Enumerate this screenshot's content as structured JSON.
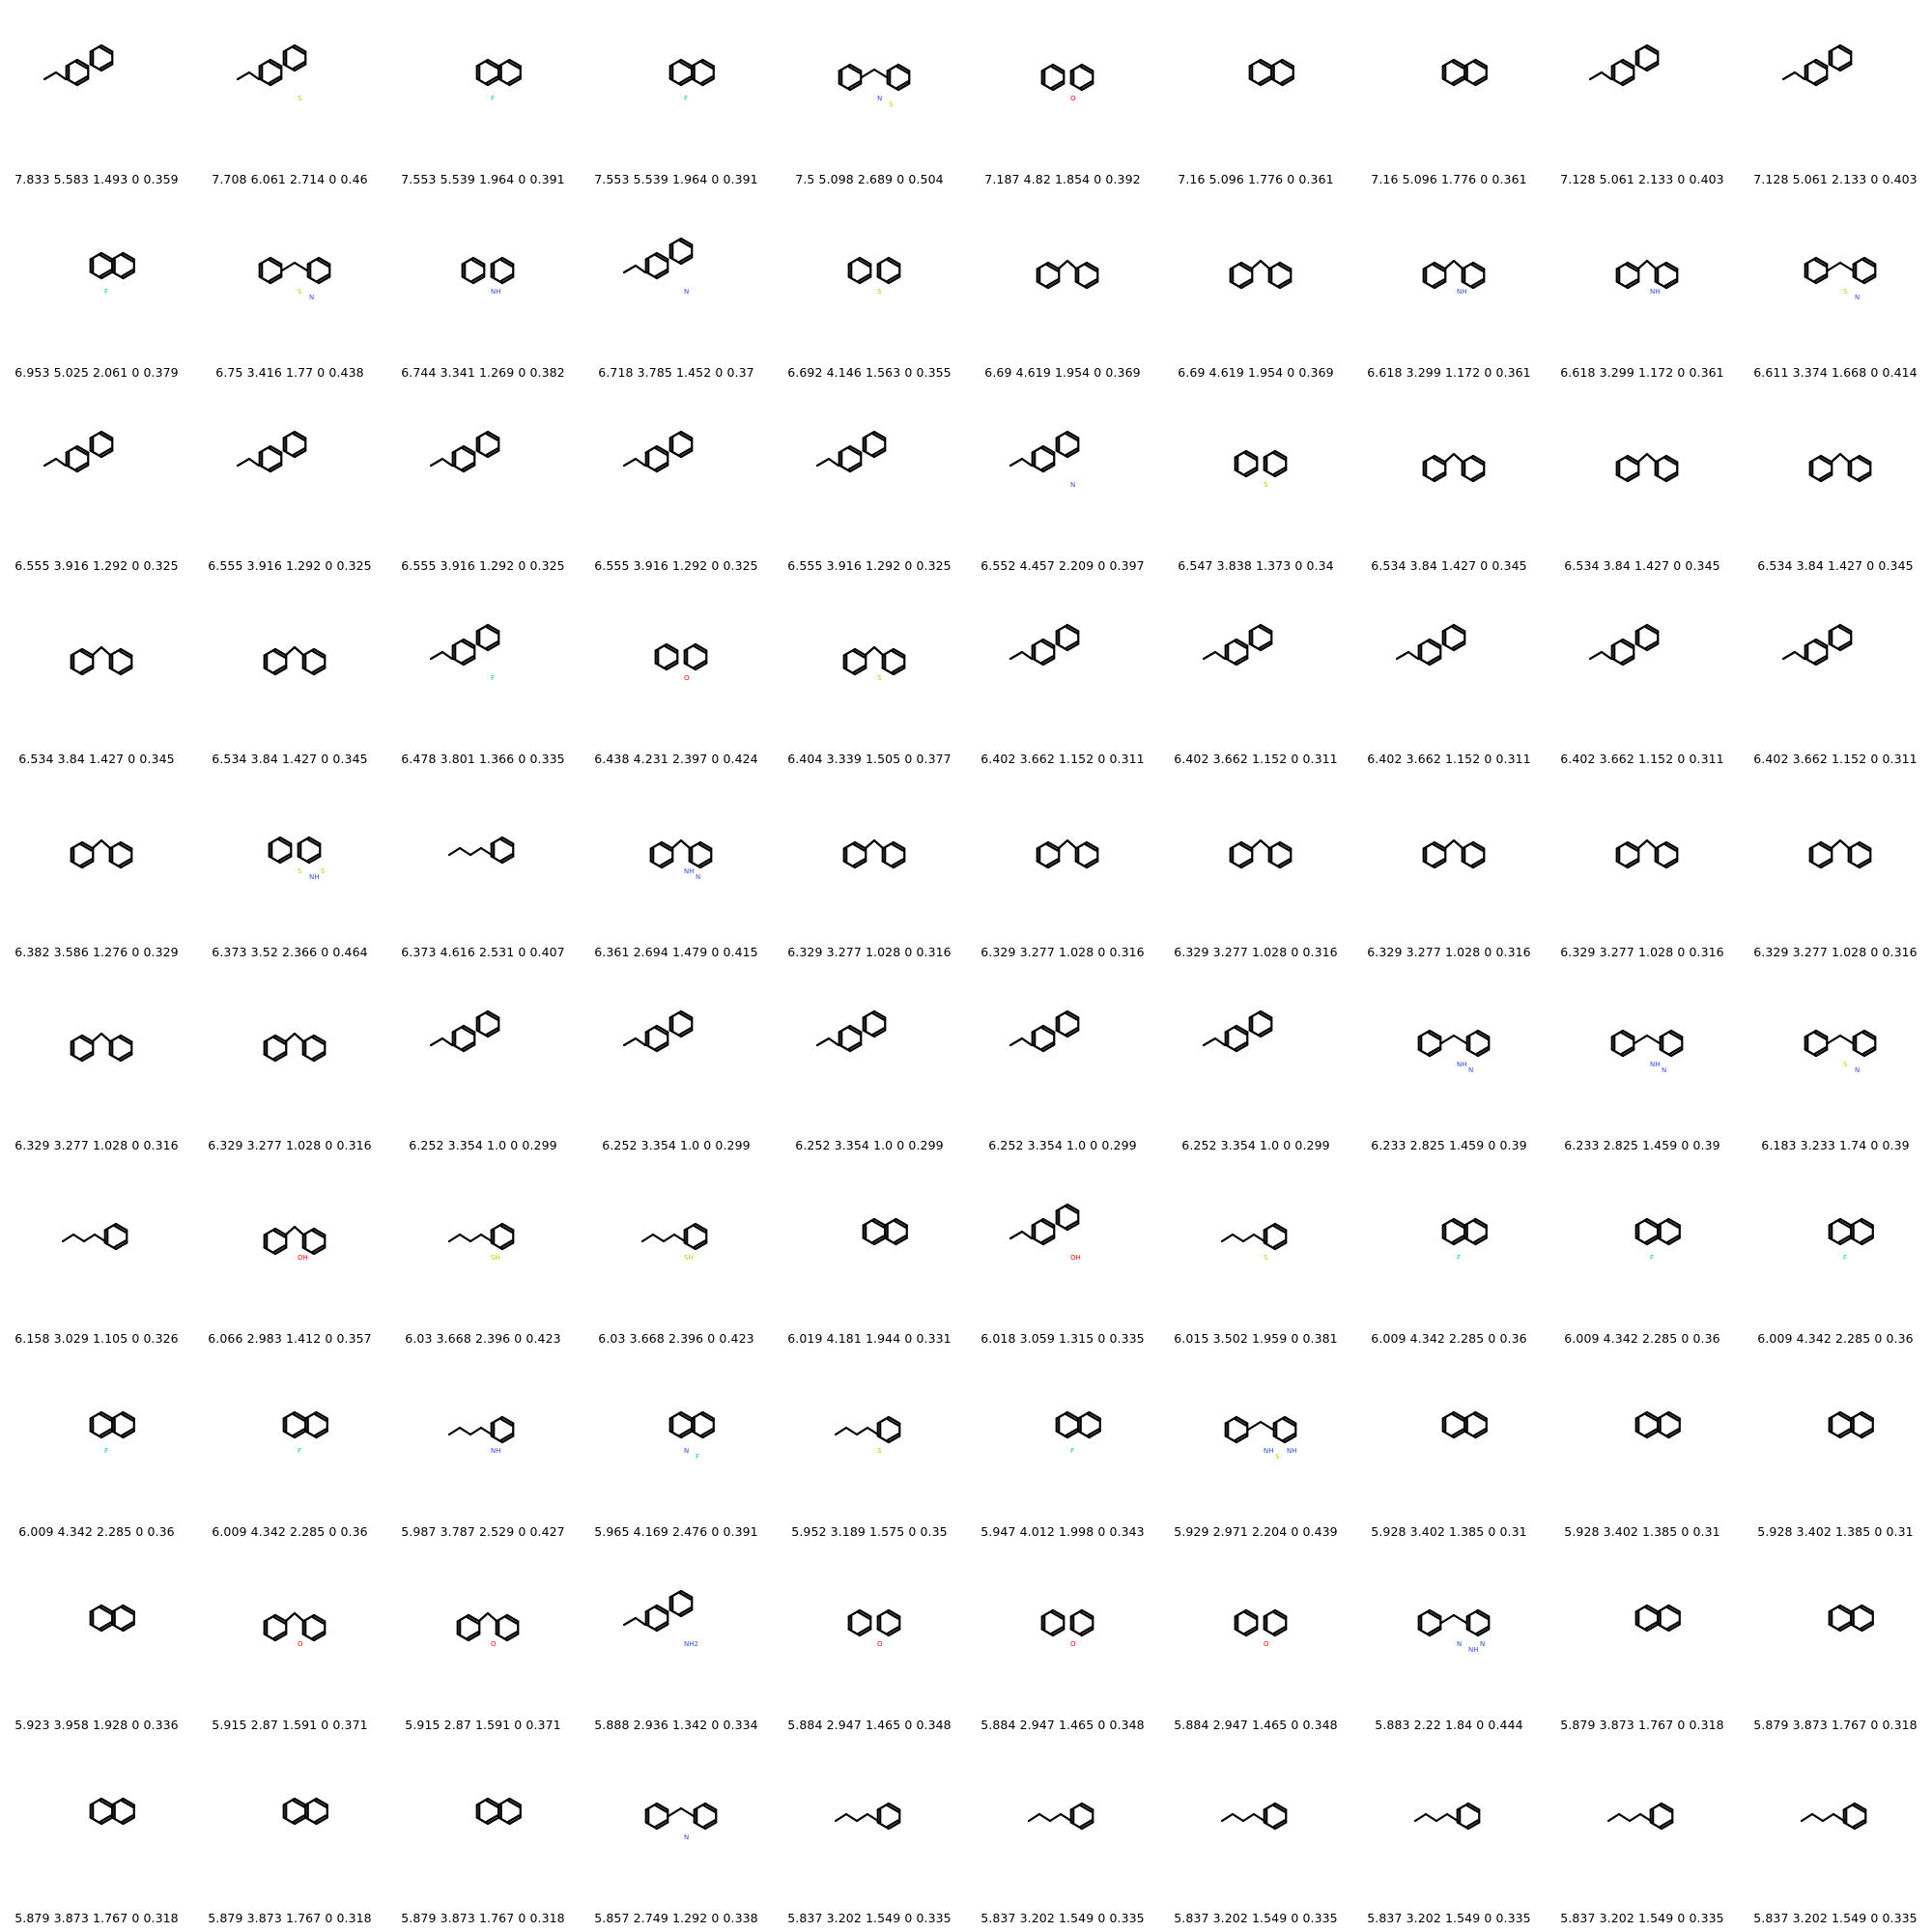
{
  "grid": {
    "rows": 10,
    "cols": 10
  },
  "bond_color": "#000000",
  "atom_colors": {
    "O": "#ff0d0d",
    "N": "#3050f8",
    "S": "#c8c800",
    "F": "#00c8c8"
  },
  "molecules": [
    {
      "caption": "7.833 5.583 1.493 0 0.359",
      "icon": "biaryl-ethyl-molecule-icon"
    },
    {
      "caption": "7.708 6.061 2.714 0 0.46",
      "icon": "biaryl-thio-diene-molecule-icon",
      "het": [
        {
          "el": "S"
        }
      ]
    },
    {
      "caption": "7.553 5.539 1.964 0 0.391",
      "icon": "naphthyl-biaryl-molecule-icon",
      "het": [
        {
          "el": "F"
        }
      ]
    },
    {
      "caption": "7.553 5.539 1.964 0 0.391",
      "icon": "naphthyl-biaryl-molecule-icon",
      "het": [
        {
          "el": "F"
        }
      ]
    },
    {
      "caption": "7.5 5.098 2.689 0 0.504",
      "icon": "pyridyl-thio-triene-molecule-icon",
      "het": [
        {
          "el": "N"
        },
        {
          "el": "S"
        }
      ]
    },
    {
      "caption": "7.187 4.82 1.854 0 0.392",
      "icon": "diaryl-ether-molecule-icon",
      "het": [
        {
          "el": "O"
        }
      ]
    },
    {
      "caption": "7.16 5.096 1.776 0 0.361",
      "icon": "naphthyl-allyl-benzene-molecule-icon"
    },
    {
      "caption": "7.16 5.096 1.776 0 0.361",
      "icon": "naphthyl-allyl-benzene-molecule-icon"
    },
    {
      "caption": "7.128 5.061 2.133 0 0.403",
      "icon": "diene-linked-biaryl-molecule-icon"
    },
    {
      "caption": "7.128 5.061 2.133 0 0.403",
      "icon": "diene-linked-biaryl-molecule-icon"
    },
    {
      "caption": "6.953 5.025 2.061 0 0.379",
      "icon": "phenanthrene-molecule-icon",
      "het": [
        {
          "el": "F"
        }
      ]
    },
    {
      "caption": "6.75 3.416 1.77 0 0.438",
      "icon": "thioether-pyridine-molecule-icon",
      "het": [
        {
          "el": "S"
        },
        {
          "el": "N"
        }
      ]
    },
    {
      "caption": "6.744 3.341 1.269 0 0.382",
      "icon": "amine-linked-benzene-molecule-icon",
      "het": [
        {
          "el": "NH"
        }
      ]
    },
    {
      "caption": "6.718 3.785 1.452 0 0.37",
      "icon": "aminobiphenyl-molecule-icon",
      "het": [
        {
          "el": "N"
        }
      ]
    },
    {
      "caption": "6.692 4.146 1.563 0 0.355",
      "icon": "diaryl-sulfide-molecule-icon",
      "het": [
        {
          "el": "S"
        }
      ]
    },
    {
      "caption": "6.69 4.619 1.954 0 0.369",
      "icon": "diarylmethane-molecule-icon"
    },
    {
      "caption": "6.69 4.619 1.954 0 0.369",
      "icon": "diarylmethane-molecule-icon"
    },
    {
      "caption": "6.618 3.299 1.172 0 0.361",
      "icon": "benzylaniline-molecule-icon",
      "het": [
        {
          "el": "NH"
        }
      ]
    },
    {
      "caption": "6.618 3.299 1.172 0 0.361",
      "icon": "benzylaniline-molecule-icon",
      "het": [
        {
          "el": "NH"
        }
      ]
    },
    {
      "caption": "6.611 3.374 1.668 0 0.414",
      "icon": "thioether-pyridine-molecule-icon",
      "het": [
        {
          "el": "S"
        },
        {
          "el": "N"
        }
      ]
    },
    {
      "caption": "6.555 3.916 1.292 0 0.325",
      "icon": "ethylbiphenyl-molecule-icon"
    },
    {
      "caption": "6.555 3.916 1.292 0 0.325",
      "icon": "ethylbiphenyl-molecule-icon"
    },
    {
      "caption": "6.555 3.916 1.292 0 0.325",
      "icon": "ethylbiphenyl-molecule-icon"
    },
    {
      "caption": "6.555 3.916 1.292 0 0.325",
      "icon": "ethylbiphenyl-molecule-icon"
    },
    {
      "caption": "6.555 3.916 1.292 0 0.325",
      "icon": "ethylbiphenyl-molecule-icon"
    },
    {
      "caption": "6.552 4.457 2.209 0 0.397",
      "icon": "azo-biphenyl-molecule-icon",
      "het": [
        {
          "el": "N"
        }
      ]
    },
    {
      "caption": "6.547 3.838 1.373 0 0.34",
      "icon": "diphenyl-sulfide-molecule-icon",
      "het": [
        {
          "el": "S"
        }
      ]
    },
    {
      "caption": "6.534 3.84 1.427 0 0.345",
      "icon": "ethyl-diphenylmethane-molecule-icon"
    },
    {
      "caption": "6.534 3.84 1.427 0 0.345",
      "icon": "ethyl-diphenylmethane-molecule-icon"
    },
    {
      "caption": "6.534 3.84 1.427 0 0.345",
      "icon": "ethyl-diphenylmethane-molecule-icon"
    },
    {
      "caption": "6.534 3.84 1.427 0 0.345",
      "icon": "ethyl-diphenylmethane-molecule-icon"
    },
    {
      "caption": "6.534 3.84 1.427 0 0.345",
      "icon": "ethyl-diphenylmethane-molecule-icon"
    },
    {
      "caption": "6.478 3.801 1.366 0 0.335",
      "icon": "fluoro-methylbiphenyl-molecule-icon",
      "het": [
        {
          "el": "F"
        }
      ]
    },
    {
      "caption": "6.438 4.231 2.397 0 0.424",
      "icon": "alkoxy-styrene-molecule-icon",
      "het": [
        {
          "el": "O"
        }
      ]
    },
    {
      "caption": "6.404 3.339 1.505 0 0.377",
      "icon": "benzylthiophene-molecule-icon",
      "het": [
        {
          "el": "S"
        }
      ]
    },
    {
      "caption": "6.402 3.662 1.152 0 0.311",
      "icon": "methylbiphenyl-molecule-icon"
    },
    {
      "caption": "6.402 3.662 1.152 0 0.311",
      "icon": "methylbiphenyl-molecule-icon"
    },
    {
      "caption": "6.402 3.662 1.152 0 0.311",
      "icon": "methylbiphenyl-molecule-icon"
    },
    {
      "caption": "6.402 3.662 1.152 0 0.311",
      "icon": "methylbiphenyl-molecule-icon"
    },
    {
      "caption": "6.402 3.662 1.152 0 0.311",
      "icon": "methylbiphenyl-molecule-icon"
    },
    {
      "caption": "6.382 3.586 1.276 0 0.329",
      "icon": "methyl-diphenylmethane-molecule-icon"
    },
    {
      "caption": "6.373 3.52 2.366 0 0.464",
      "icon": "thiazine-imine-molecule-icon",
      "het": [
        {
          "el": "S"
        },
        {
          "el": "NH"
        },
        {
          "el": "S"
        }
      ]
    },
    {
      "caption": "6.373 4.616 2.531 0 0.407",
      "icon": "polyene-toluene-molecule-icon"
    },
    {
      "caption": "6.361 2.694 1.479 0 0.415",
      "icon": "benzylaminopyridine-molecule-icon",
      "het": [
        {
          "el": "NH"
        },
        {
          "el": "N"
        }
      ]
    },
    {
      "caption": "6.329 3.277 1.028 0 0.316",
      "icon": "diphenylmethane-molecule-icon"
    },
    {
      "caption": "6.329 3.277 1.028 0 0.316",
      "icon": "diphenylmethane-molecule-icon"
    },
    {
      "caption": "6.329 3.277 1.028 0 0.316",
      "icon": "diphenylmethane-molecule-icon"
    },
    {
      "caption": "6.329 3.277 1.028 0 0.316",
      "icon": "diphenylmethane-molecule-icon"
    },
    {
      "caption": "6.329 3.277 1.028 0 0.316",
      "icon": "diphenylmethane-molecule-icon"
    },
    {
      "caption": "6.329 3.277 1.028 0 0.316",
      "icon": "diphenylmethane-molecule-icon"
    },
    {
      "caption": "6.329 3.277 1.028 0 0.316",
      "icon": "diphenylmethane-molecule-icon"
    },
    {
      "caption": "6.329 3.277 1.028 0 0.316",
      "icon": "diphenylmethane-molecule-icon"
    },
    {
      "caption": "6.252 3.354 1.0 0 0.299",
      "icon": "biphenyl-molecule-icon"
    },
    {
      "caption": "6.252 3.354 1.0 0 0.299",
      "icon": "biphenyl-molecule-icon"
    },
    {
      "caption": "6.252 3.354 1.0 0 0.299",
      "icon": "biphenyl-molecule-icon"
    },
    {
      "caption": "6.252 3.354 1.0 0 0.299",
      "icon": "biphenyl-molecule-icon"
    },
    {
      "caption": "6.252 3.354 1.0 0 0.299",
      "icon": "biphenyl-molecule-icon"
    },
    {
      "caption": "6.233 2.825 1.459 0 0.39",
      "icon": "anilinopyridine-molecule-icon",
      "het": [
        {
          "el": "NH"
        },
        {
          "el": "N"
        }
      ]
    },
    {
      "caption": "6.233 2.825 1.459 0 0.39",
      "icon": "anilinopyridine-molecule-icon",
      "het": [
        {
          "el": "NH"
        },
        {
          "el": "N"
        }
      ]
    },
    {
      "caption": "6.183 3.233 1.74 0 0.39",
      "icon": "phenylthiopyridine-molecule-icon",
      "het": [
        {
          "el": "S"
        },
        {
          "el": "N"
        }
      ]
    },
    {
      "caption": "6.158 3.029 1.105 0 0.326",
      "icon": "propylbenzene-molecule-icon"
    },
    {
      "caption": "6.066 2.983 1.412 0 0.357",
      "icon": "benzylphenol-molecule-icon",
      "het": [
        {
          "el": "OH"
        }
      ]
    },
    {
      "caption": "6.03 3.668 2.396 0 0.423",
      "icon": "thiol-chain-benzene-molecule-icon",
      "het": [
        {
          "el": "SH"
        }
      ]
    },
    {
      "caption": "6.03 3.668 2.396 0 0.423",
      "icon": "thiol-chain-benzene-molecule-icon",
      "het": [
        {
          "el": "SH"
        }
      ]
    },
    {
      "caption": "6.019 4.181 1.944 0 0.331",
      "icon": "propenyl-methylnaphthalene-molecule-icon"
    },
    {
      "caption": "6.018 3.059 1.315 0 0.335",
      "icon": "hydroxybiphenyl-molecule-icon",
      "het": [
        {
          "el": "OH"
        }
      ]
    },
    {
      "caption": "6.015 3.502 1.959 0 0.381",
      "icon": "thioether-propylbenzene-molecule-icon",
      "het": [
        {
          "el": "S"
        }
      ]
    },
    {
      "caption": "6.009 4.342 2.285 0 0.36",
      "icon": "propenyl-fluoromethylnaphthalene-molecule-icon",
      "het": [
        {
          "el": "F"
        }
      ]
    },
    {
      "caption": "6.009 4.342 2.285 0 0.36",
      "icon": "propenyl-fluoromethylnaphthalene-molecule-icon",
      "het": [
        {
          "el": "F"
        }
      ]
    },
    {
      "caption": "6.009 4.342 2.285 0 0.36",
      "icon": "propenyl-fluoromethylnaphthalene-molecule-icon",
      "het": [
        {
          "el": "F"
        }
      ]
    },
    {
      "caption": "6.009 4.342 2.285 0 0.36",
      "icon": "propenyl-fluoromethylnaphthalene-molecule-icon",
      "het": [
        {
          "el": "F"
        }
      ]
    },
    {
      "caption": "6.009 4.342 2.285 0 0.36",
      "icon": "propenyl-fluoromethylnaphthalene-molecule-icon",
      "het": [
        {
          "el": "F"
        }
      ]
    },
    {
      "caption": "5.987 3.787 2.529 0 0.427",
      "icon": "dienyl-aniline-molecule-icon",
      "het": [
        {
          "el": "NH"
        }
      ]
    },
    {
      "caption": "5.965 4.169 2.476 0 0.391",
      "icon": "propenyl-naphthylamine-molecule-icon",
      "het": [
        {
          "el": "N"
        },
        {
          "el": "F"
        }
      ]
    },
    {
      "caption": "5.952 3.189 1.575 0 0.35",
      "icon": "propylthio-benzene-molecule-icon",
      "het": [
        {
          "el": "S"
        }
      ]
    },
    {
      "caption": "5.947 4.012 1.998 0 0.343",
      "icon": "propenyl-fluoronaphthalene-molecule-icon",
      "het": [
        {
          "el": "F"
        }
      ]
    },
    {
      "caption": "5.929 2.971 2.204 0 0.439",
      "icon": "thiazine-anilino-molecule-icon",
      "het": [
        {
          "el": "NH"
        },
        {
          "el": "S"
        },
        {
          "el": "NH"
        }
      ]
    },
    {
      "caption": "5.928 3.402 1.385 0 0.31",
      "icon": "ethylnaphthalene-molecule-icon"
    },
    {
      "caption": "5.928 3.402 1.385 0 0.31",
      "icon": "ethylnaphthalene-molecule-icon"
    },
    {
      "caption": "5.928 3.402 1.385 0 0.31",
      "icon": "ethylnaphthalene-molecule-icon"
    },
    {
      "caption": "5.923 3.958 1.928 0 0.336",
      "icon": "butenyl-naphthalene-molecule-icon"
    },
    {
      "caption": "5.915 2.87 1.591 0 0.371",
      "icon": "benzylfuran-molecule-icon",
      "het": [
        {
          "el": "O"
        }
      ]
    },
    {
      "caption": "5.915 2.87 1.591 0 0.371",
      "icon": "benzylfuran-molecule-icon",
      "het": [
        {
          "el": "O"
        }
      ]
    },
    {
      "caption": "5.888 2.936 1.342 0 0.334",
      "icon": "aminobiphenyl-molecule-icon",
      "het": [
        {
          "el": "NH2"
        }
      ]
    },
    {
      "caption": "5.884 2.947 1.465 0 0.348",
      "icon": "phenylfuran-molecule-icon",
      "het": [
        {
          "el": "O"
        }
      ]
    },
    {
      "caption": "5.884 2.947 1.465 0 0.348",
      "icon": "phenylfuran-molecule-icon",
      "het": [
        {
          "el": "O"
        }
      ]
    },
    {
      "caption": "5.884 2.947 1.465 0 0.348",
      "icon": "phenylfuran-molecule-icon",
      "het": [
        {
          "el": "O"
        }
      ]
    },
    {
      "caption": "5.883 2.22 1.84 0 0.444",
      "icon": "dipyridylamine-molecule-icon",
      "het": [
        {
          "el": "N"
        },
        {
          "el": "NH"
        },
        {
          "el": "N"
        }
      ]
    },
    {
      "caption": "5.879 3.873 1.767 0 0.318",
      "icon": "propenyl-naphthalene-molecule-icon"
    },
    {
      "caption": "5.879 3.873 1.767 0 0.318",
      "icon": "propenyl-naphthalene-molecule-icon"
    },
    {
      "caption": "5.879 3.873 1.767 0 0.318",
      "icon": "propenyl-naphthalene-molecule-icon"
    },
    {
      "caption": "5.879 3.873 1.767 0 0.318",
      "icon": "propenyl-naphthalene-molecule-icon"
    },
    {
      "caption": "5.879 3.873 1.767 0 0.318",
      "icon": "propenyl-naphthalene-molecule-icon"
    },
    {
      "caption": "5.857 2.749 1.292 0 0.338",
      "icon": "phenylpyridine-molecule-icon",
      "het": [
        {
          "el": "N"
        }
      ]
    },
    {
      "caption": "5.837 3.202 1.549 0 0.335",
      "icon": "ethyl-propylbenzene-molecule-icon"
    },
    {
      "caption": "5.837 3.202 1.549 0 0.335",
      "icon": "ethyl-propylbenzene-molecule-icon"
    },
    {
      "caption": "5.837 3.202 1.549 0 0.335",
      "icon": "ethyl-propylbenzene-molecule-icon"
    },
    {
      "caption": "5.837 3.202 1.549 0 0.335",
      "icon": "ethyl-propylbenzene-molecule-icon"
    },
    {
      "caption": "5.837 3.202 1.549 0 0.335",
      "icon": "ethyl-propylbenzene-molecule-icon"
    },
    {
      "caption": "5.837 3.202 1.549 0 0.335",
      "icon": "ethyl-propylbenzene-molecule-icon"
    }
  ]
}
